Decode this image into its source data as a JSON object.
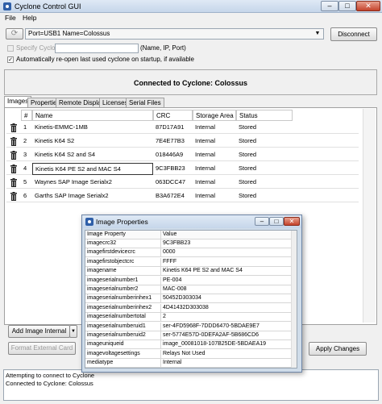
{
  "window": {
    "title": "Cyclone Control GUI"
  },
  "menu": [
    "File",
    "Help"
  ],
  "connection": {
    "refresh_icon": "refresh-icon",
    "port_value": "Port=USB1  Name=Colossus",
    "disconnect_label": "Disconnect",
    "specify_label": "Specify Cyclone",
    "specify_placeholder": "",
    "specify_hint": "(Name, IP, Port)",
    "reopen_label": "Automatically re-open last used cyclone on startup, if available",
    "status": "Connected to Cyclone: Colossus"
  },
  "tabs": [
    "Images",
    "Properties",
    "Remote Display",
    "Licenses",
    "Serial Files"
  ],
  "images": {
    "headers": [
      "#",
      "Name",
      "CRC",
      "Storage Area",
      "Status"
    ],
    "rows": [
      {
        "num": "1",
        "name": "Kinetis-EMMC-1MB",
        "crc": "87D17A91",
        "area": "Internal",
        "status": "Stored"
      },
      {
        "num": "2",
        "name": "Kinetis K64 S2",
        "crc": "7E4E77B3",
        "area": "Internal",
        "status": "Stored"
      },
      {
        "num": "3",
        "name": "Kinetis K64 S2 and S4",
        "crc": "018446A9",
        "area": "Internal",
        "status": "Stored"
      },
      {
        "num": "4",
        "name": "Kinetis K64 PE S2 and MAC S4",
        "crc": "9C3FBB23",
        "area": "Internal",
        "status": "Stored"
      },
      {
        "num": "5",
        "name": "Waynes SAP Image Serialx2",
        "crc": "063DCC47",
        "area": "Internal",
        "status": "Stored"
      },
      {
        "num": "6",
        "name": "Garths SAP Image Serialx2",
        "crc": "B3A672E4",
        "area": "Internal",
        "status": "Stored"
      }
    ]
  },
  "buttons": {
    "add_image": "Add Image Internal",
    "add_dropdown": "▼",
    "format_card": "Format External Card",
    "apply": "Apply Changes"
  },
  "log": [
    "Attempting to connect to Cyclone",
    "Connected to Cyclone: Colossus"
  ],
  "dialog": {
    "title": "Image Properties",
    "headers": [
      "Image Property",
      "Value"
    ],
    "rows": [
      {
        "k": "imagecrc32",
        "v": "9C3FBB23"
      },
      {
        "k": "imagefirstdevicecrc",
        "v": "0000"
      },
      {
        "k": "imagefirstobjectcrc",
        "v": "FFFF"
      },
      {
        "k": "imagename",
        "v": "Kinetis K64 PE S2 and MAC S4"
      },
      {
        "k": "imageserialnumber1",
        "v": "PE-004"
      },
      {
        "k": "imageserialnumber2",
        "v": "MAC-008"
      },
      {
        "k": "imageserialnumberinhex1",
        "v": "50452D303034"
      },
      {
        "k": "imageserialnumberinhex2",
        "v": "4D41432D303038"
      },
      {
        "k": "imageserialnumbertotal",
        "v": "2"
      },
      {
        "k": "imageserialnumberuid1",
        "v": "ser-4FD5968F-7DDD6470-5BDAE9E7"
      },
      {
        "k": "imageserialnumberuid2",
        "v": "ser-5774E57D-0DEFA2AF-5B686CD6"
      },
      {
        "k": "imageuniqueid",
        "v": "image_00081018-107B25DE-5BDAEA19"
      },
      {
        "k": "imagevoltagesettings",
        "v": "Relays Not Used"
      },
      {
        "k": "mediatype",
        "v": "Internal"
      }
    ]
  }
}
